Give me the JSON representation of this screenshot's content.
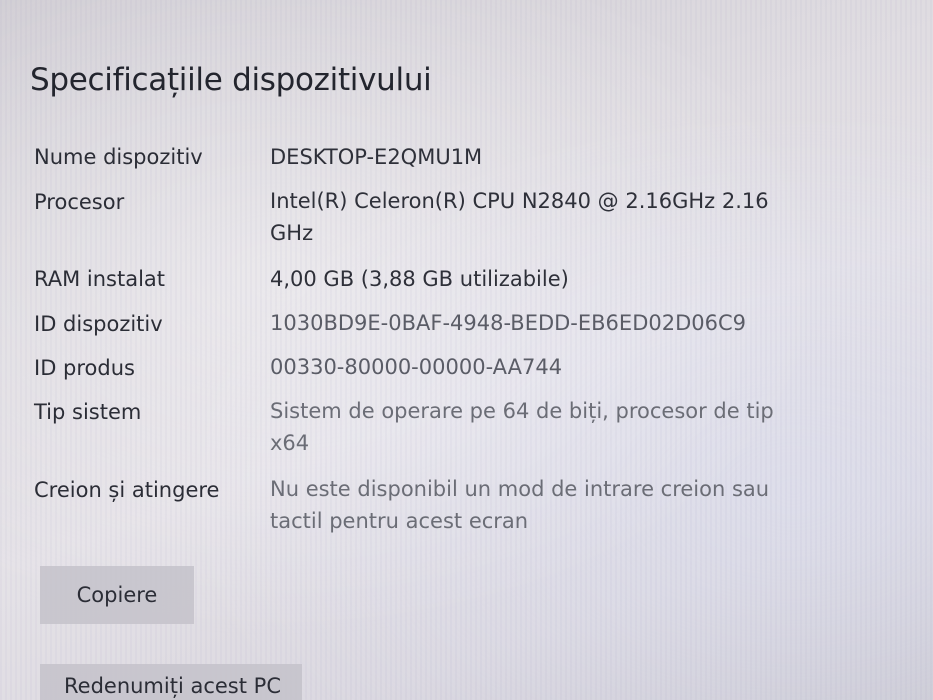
{
  "page": {
    "title": "Specificațiile dispozitivului"
  },
  "specs": [
    {
      "label": "Nume dispozitiv",
      "value": "DESKTOP-E2QMU1M"
    },
    {
      "label": "Procesor",
      "value": "Intel(R) Celeron(R) CPU  N2840  @ 2.16GHz   2.16 GHz"
    },
    {
      "label": "RAM instalat",
      "value": "4,00 GB (3,88 GB utilizabile)"
    },
    {
      "label": "ID dispozitiv",
      "value": "1030BD9E-0BAF-4948-BEDD-EB6ED02D06C9"
    },
    {
      "label": "ID produs",
      "value": "00330-80000-00000-AA744"
    },
    {
      "label": "Tip sistem",
      "value": "Sistem de operare pe 64 de biți, procesor de tip x64"
    },
    {
      "label": "Creion și atingere",
      "value": "Nu este disponibil un mod de intrare creion sau tactil pentru acest ecran"
    }
  ],
  "buttons": {
    "copy_label": "Copiere",
    "rename_label": "Redenumiți acest PC"
  }
}
